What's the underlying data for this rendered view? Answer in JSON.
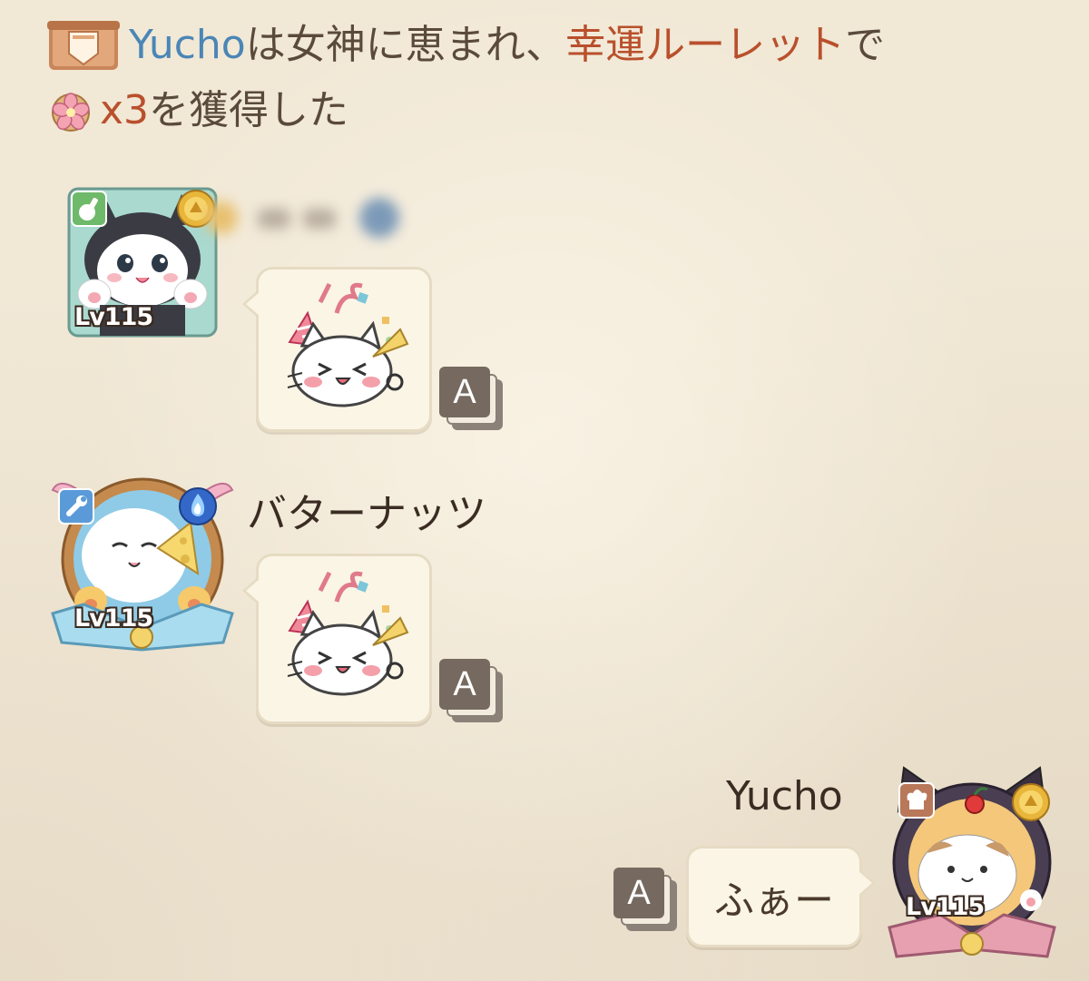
{
  "system_message": {
    "player_name": "Yucho",
    "text_part1": "は女神に恵まれ、",
    "event_name": "幸運ルーレット",
    "text_part2": "で",
    "reward_count": "x3",
    "text_part3": "を獲得した",
    "banner_icon": "banner-shield-icon",
    "reward_icon": "pink-flower-icon"
  },
  "messages": [
    {
      "sender": "",
      "level": "Lv115",
      "type": "sticker",
      "sticker": "party-cat-sticker",
      "translate_label": "A",
      "role_icon": "potion-icon",
      "badge_icon": "gold-medal-icon"
    },
    {
      "sender": "バターナッツ",
      "level": "Lv115",
      "type": "sticker",
      "sticker": "party-cat-sticker",
      "translate_label": "A",
      "role_icon": "wrench-icon",
      "badge_icon": "blue-flame-icon"
    },
    {
      "sender": "Yucho",
      "level": "Lv115",
      "type": "text",
      "text": "ふぁー",
      "translate_label": "A",
      "role_icon": "chef-hat-icon",
      "badge_icon": "gold-medal-icon"
    }
  ],
  "colors": {
    "background": "#f1e8d6",
    "name_blue": "#4a86b6",
    "accent_red": "#b9502c",
    "bubble": "#fbf5e6"
  }
}
